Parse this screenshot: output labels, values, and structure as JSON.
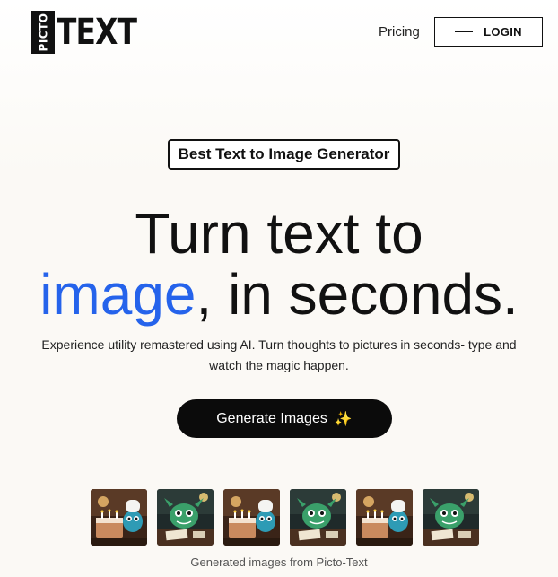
{
  "header": {
    "logo_vertical": "PICTO",
    "logo_main": "TEXT",
    "nav_pricing": "Pricing",
    "login_label": "LOGIN"
  },
  "hero": {
    "badge": "Best Text to Image Generator",
    "headline_line1": "Turn text to",
    "headline_accent": "image",
    "headline_rest": ", in seconds.",
    "subtitle": "Experience utility remastered using AI. Turn thoughts to pictures in seconds- type and watch the magic happen.",
    "cta_label": "Generate Images",
    "cta_icon": "sparkles-icon",
    "accent_color": "#2563eb"
  },
  "gallery": {
    "images": [
      {
        "name": "generated-image-1",
        "kind": "chef-cake"
      },
      {
        "name": "generated-image-2",
        "kind": "monster-desk"
      },
      {
        "name": "generated-image-3",
        "kind": "chef-cake"
      },
      {
        "name": "generated-image-4",
        "kind": "monster-desk"
      },
      {
        "name": "generated-image-5",
        "kind": "chef-cake"
      },
      {
        "name": "generated-image-6",
        "kind": "monster-desk"
      }
    ],
    "caption": "Generated images from Picto-Text"
  }
}
